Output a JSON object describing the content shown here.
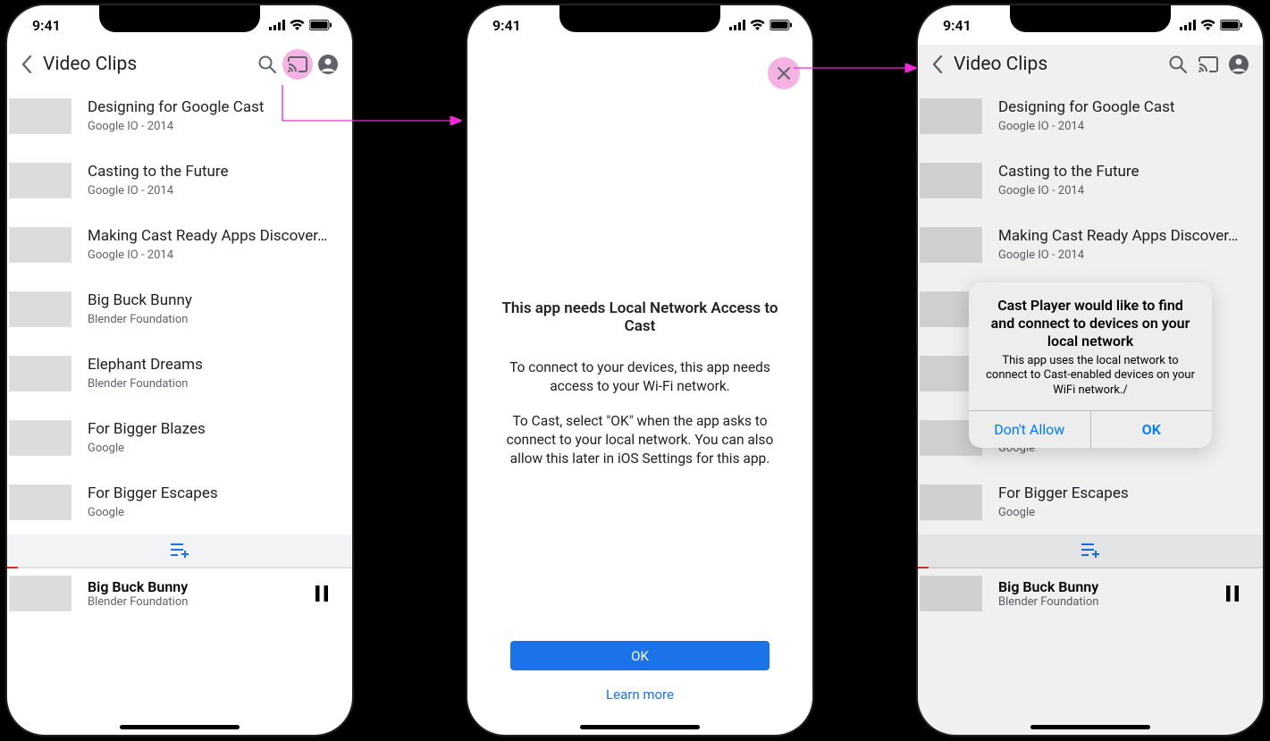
{
  "status": {
    "time": "9:41"
  },
  "appbar": {
    "title": "Video Clips"
  },
  "videos": [
    {
      "title": "Designing for Google Cast",
      "subtitle": "Google IO - 2014",
      "thumb_class": "th-blue"
    },
    {
      "title": "Casting to the Future",
      "subtitle": "Google IO - 2014",
      "thumb_class": "th-teal"
    },
    {
      "title": "Making Cast Ready Apps Discover…",
      "subtitle": "Google IO - 2014",
      "thumb_class": "th-room"
    },
    {
      "title": "Big Buck Bunny",
      "subtitle": "Blender Foundation",
      "thumb_class": "th-bunny"
    },
    {
      "title": "Elephant Dreams",
      "subtitle": "Blender Foundation",
      "thumb_class": "th-dark"
    },
    {
      "title": "For Bigger Blazes",
      "subtitle": "Google",
      "thumb_class": "th-fire"
    },
    {
      "title": "For Bigger Escapes",
      "subtitle": "Google",
      "thumb_class": "th-fire2"
    }
  ],
  "now_playing": {
    "title": "Big Buck Bunny",
    "subtitle": "Blender Foundation"
  },
  "interstitial": {
    "title": "This app needs Local Network Access to Cast",
    "body1": "To connect to your devices, this app needs access to your Wi-Fi network.",
    "body2": "To Cast, select \"OK\" when the app asks to connect to your local network. You can also allow this later in iOS Settings for this app.",
    "ok": "OK",
    "learn_more": "Learn more"
  },
  "alert": {
    "title": "Cast Player would like to find and connect to devices on your local network",
    "msg": "This app uses the local network to connect to Cast-enabled devices on your WiFi network./",
    "dont_allow": "Don't Allow",
    "ok": "OK"
  }
}
